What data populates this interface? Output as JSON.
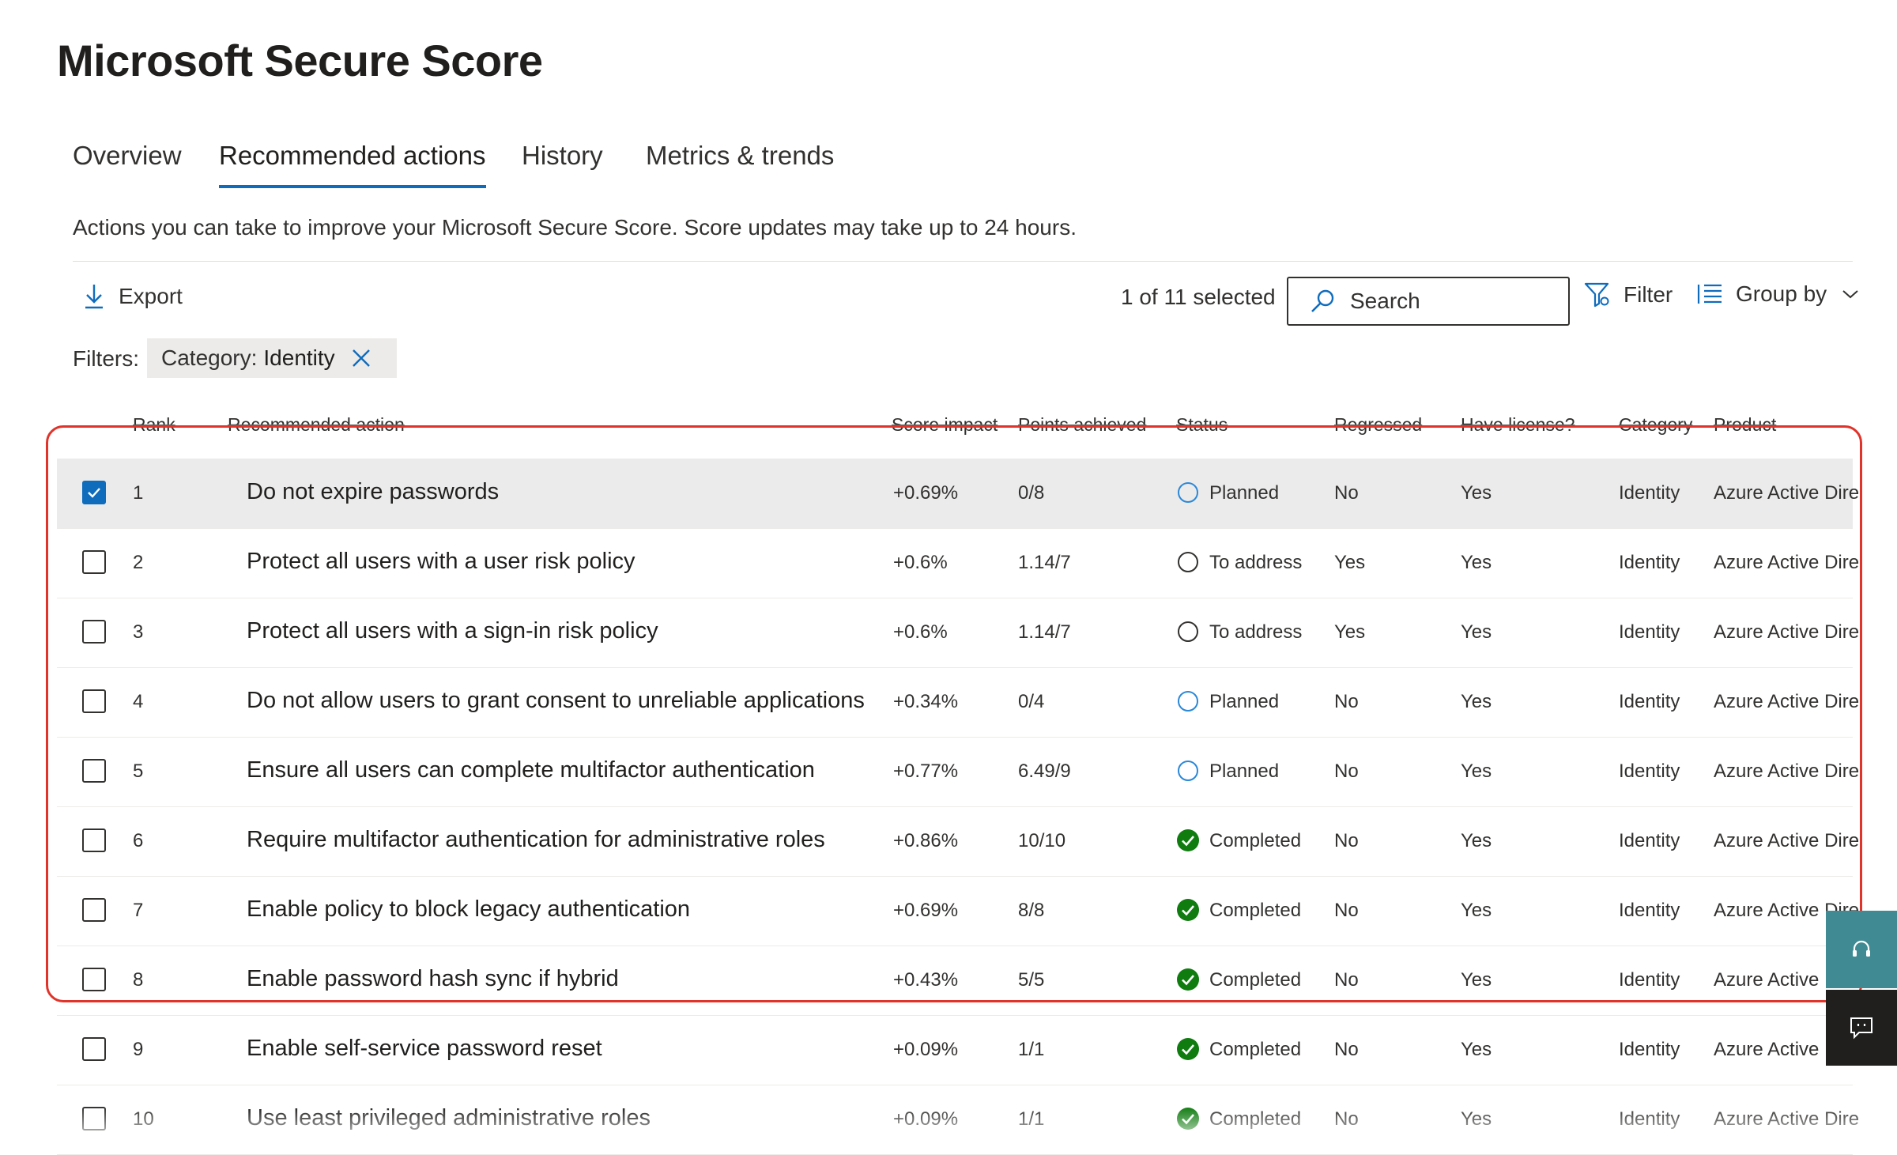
{
  "page": {
    "title": "Microsoft Secure Score"
  },
  "tabs": [
    {
      "label": "Overview",
      "active": false
    },
    {
      "label": "Recommended actions",
      "active": true
    },
    {
      "label": "History",
      "active": false
    },
    {
      "label": "Metrics & trends",
      "active": false
    }
  ],
  "description": "Actions you can take to improve your Microsoft Secure Score. Score updates may take up to 24 hours.",
  "toolbar": {
    "export_label": "Export",
    "selected_text": "1 of 11 selected",
    "search_placeholder": "Search",
    "filter_label": "Filter",
    "group_by_label": "Group by"
  },
  "filters": {
    "label": "Filters:",
    "pill_key": "Category:",
    "pill_value": "Identity"
  },
  "table": {
    "columns": {
      "rank": "Rank",
      "action": "Recommended action",
      "score_impact": "Score impact",
      "points": "Points achieved",
      "status": "Status",
      "regressed": "Regressed",
      "license": "Have license?",
      "category": "Category",
      "product": "Product"
    },
    "rows": [
      {
        "checked": true,
        "rank": "1",
        "action": "Do not expire passwords",
        "score_impact": "+0.69%",
        "points": "0/8",
        "status": "Planned",
        "status_type": "planned",
        "regressed": "No",
        "license": "Yes",
        "category": "Identity",
        "product": "Azure Active Dire"
      },
      {
        "checked": false,
        "rank": "2",
        "action": "Protect all users with a user risk policy",
        "score_impact": "+0.6%",
        "points": "1.14/7",
        "status": "To address",
        "status_type": "toaddress",
        "regressed": "Yes",
        "license": "Yes",
        "category": "Identity",
        "product": "Azure Active Dire"
      },
      {
        "checked": false,
        "rank": "3",
        "action": "Protect all users with a sign-in risk policy",
        "score_impact": "+0.6%",
        "points": "1.14/7",
        "status": "To address",
        "status_type": "toaddress",
        "regressed": "Yes",
        "license": "Yes",
        "category": "Identity",
        "product": "Azure Active Dire"
      },
      {
        "checked": false,
        "rank": "4",
        "action": "Do not allow users to grant consent to unreliable applications",
        "score_impact": "+0.34%",
        "points": "0/4",
        "status": "Planned",
        "status_type": "planned",
        "regressed": "No",
        "license": "Yes",
        "category": "Identity",
        "product": "Azure Active Dire"
      },
      {
        "checked": false,
        "rank": "5",
        "action": "Ensure all users can complete multifactor authentication",
        "score_impact": "+0.77%",
        "points": "6.49/9",
        "status": "Planned",
        "status_type": "planned",
        "regressed": "No",
        "license": "Yes",
        "category": "Identity",
        "product": "Azure Active Dire"
      },
      {
        "checked": false,
        "rank": "6",
        "action": "Require multifactor authentication for administrative roles",
        "score_impact": "+0.86%",
        "points": "10/10",
        "status": "Completed",
        "status_type": "completed",
        "regressed": "No",
        "license": "Yes",
        "category": "Identity",
        "product": "Azure Active Dire"
      },
      {
        "checked": false,
        "rank": "7",
        "action": "Enable policy to block legacy authentication",
        "score_impact": "+0.69%",
        "points": "8/8",
        "status": "Completed",
        "status_type": "completed",
        "regressed": "No",
        "license": "Yes",
        "category": "Identity",
        "product": "Azure Active Dire"
      },
      {
        "checked": false,
        "rank": "8",
        "action": "Enable password hash sync if hybrid",
        "score_impact": "+0.43%",
        "points": "5/5",
        "status": "Completed",
        "status_type": "completed",
        "regressed": "No",
        "license": "Yes",
        "category": "Identity",
        "product": "Azure Active"
      },
      {
        "checked": false,
        "rank": "9",
        "action": "Enable self-service password reset",
        "score_impact": "+0.09%",
        "points": "1/1",
        "status": "Completed",
        "status_type": "completed",
        "regressed": "No",
        "license": "Yes",
        "category": "Identity",
        "product": "Azure Active"
      },
      {
        "checked": false,
        "rank": "10",
        "action": "Use least privileged administrative roles",
        "score_impact": "+0.09%",
        "points": "1/1",
        "status": "Completed",
        "status_type": "completed",
        "regressed": "No",
        "license": "Yes",
        "category": "Identity",
        "product": "Azure Active Dire"
      }
    ]
  },
  "colors": {
    "accent": "#0f6cbd",
    "completed": "#107c10",
    "planned": "#2b88d8",
    "highlight": "#e0332a",
    "support_button": "#3f8a93"
  }
}
